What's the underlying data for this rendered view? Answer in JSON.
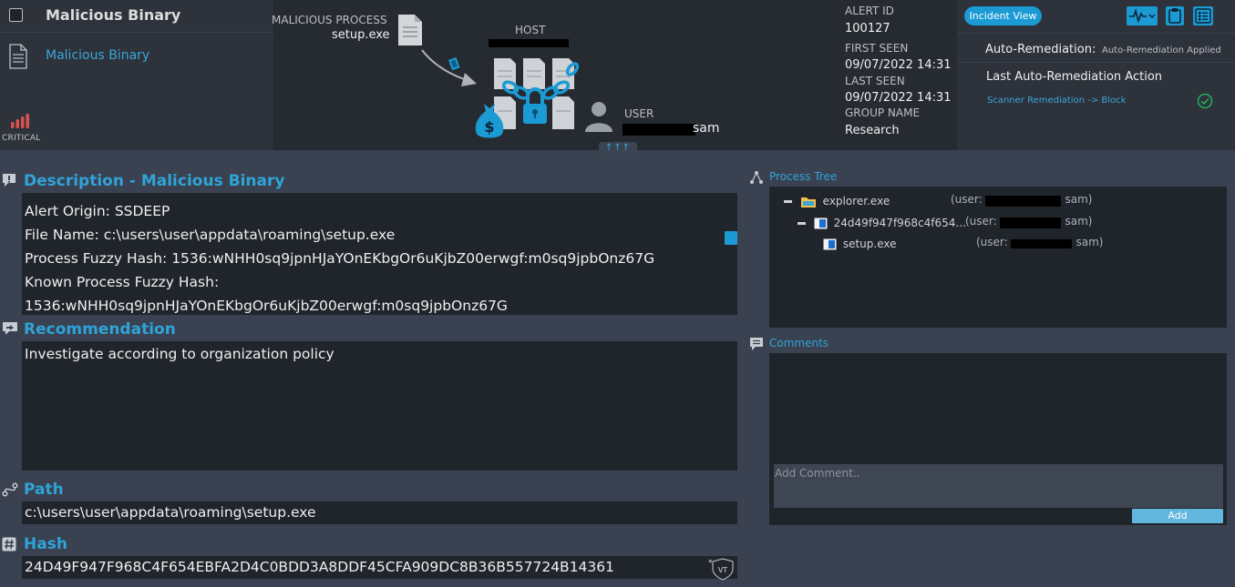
{
  "header": {
    "alert_title": "Malicious Binary",
    "alert_link": "Malicious Binary",
    "severity_label": "CRITICAL"
  },
  "graphic": {
    "process_label": "MALICIOUS PROCESS",
    "process_name": "setup.exe",
    "host_label": "HOST",
    "user_label": "USER",
    "user_suffix": "sam",
    "expand_label": "↑↑↑"
  },
  "meta": {
    "alert_id_label": "ALERT ID",
    "alert_id": "100127",
    "first_seen_label": "FIRST SEEN",
    "first_seen": "09/07/2022 14:31",
    "last_seen_label": "LAST SEEN",
    "last_seen": "09/07/2022 14:31",
    "group_label": "GROUP NAME",
    "group": "Research"
  },
  "actions": {
    "incident_view": "Incident View",
    "auto_remediation_label": "Auto-Remediation:",
    "auto_remediation_value": "Auto-Remediation Applied",
    "last_action_label": "Last Auto-Remediation Action",
    "last_action_value": "Scanner Remediation -> Block"
  },
  "description": {
    "title": "Description - Malicious Binary",
    "lines": [
      "Alert Origin: SSDEEP",
      "File Name: c:\\users\\user\\appdata\\roaming\\setup.exe",
      "Process Fuzzy Hash: 1536:wNHH0sq9jpnHJaYOnEKbgOr6uKjbZ00erwgf:m0sq9jpbOnz67G",
      "Known Process Fuzzy Hash:",
      "1536:wNHH0sq9jpnHJaYOnEKbgOr6uKjbZ00erwgf:m0sq9jpbOnz67G"
    ]
  },
  "recommendation": {
    "title": "Recommendation",
    "text": "Investigate according to organization policy"
  },
  "path": {
    "title": "Path",
    "value": "c:\\users\\user\\appdata\\roaming\\setup.exe"
  },
  "hash": {
    "title": "Hash",
    "value": "24D49F947F968C4F654EBFA2D4C0BDD3A8DDF45CFA909DC8B36B557724B14361",
    "vt_label": "VT"
  },
  "process_tree": {
    "title": "Process Tree",
    "user_prefix": "(user:",
    "rows": [
      {
        "name": "explorer.exe",
        "user_suffix": "sam)"
      },
      {
        "name": "24d49f947f968c4f654...",
        "user_suffix": "sam)"
      },
      {
        "name": "setup.exe",
        "user_suffix": "sam)"
      }
    ]
  },
  "comments": {
    "title": "Comments",
    "placeholder": "Add Comment..",
    "add_label": "Add"
  },
  "colors": {
    "accent": "#2fa4d9",
    "button": "#1b9ad4",
    "background": "#3a4150",
    "panel": "#20242b",
    "critical": "#d9534f",
    "success": "#27ae60"
  }
}
